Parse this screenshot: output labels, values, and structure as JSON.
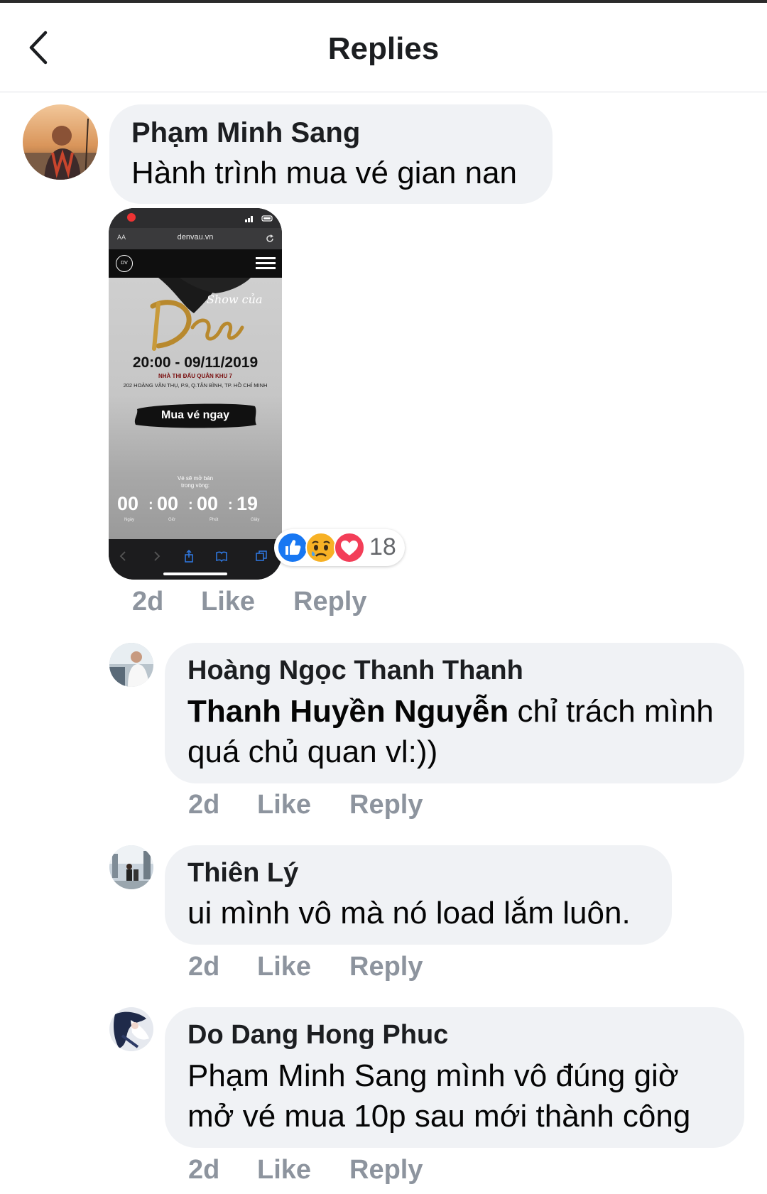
{
  "header": {
    "title": "Replies"
  },
  "main_comment": {
    "author": "Phạm Minh Sang",
    "text": "Hành trình mua vé gian nan",
    "image": {
      "url": "denvau.vn",
      "aa": "AA",
      "logo": "DV",
      "show_title": "Show của Đen",
      "date": "20:00 - 09/11/2019",
      "venue": "NHÀ THI ĐẤU QUÂN KHU 7",
      "address": "202 HOÀNG VĂN THỤ, P.9, Q.TÂN BÌNH, TP. HỒ CHÍ MINH",
      "button": "Mua vé ngay",
      "sale_note_1": "Vé sẽ mở bán",
      "sale_note_2": "trong vòng:",
      "countdown": {
        "days": "00",
        "hours": "00",
        "minutes": "00",
        "seconds": "19"
      },
      "units": {
        "days": "Ngày",
        "hours": "Giờ",
        "minutes": "Phút",
        "seconds": "Giây"
      }
    },
    "reactions": {
      "icons": [
        "like-icon",
        "sad-icon",
        "love-icon"
      ],
      "count": "18"
    },
    "time": "2d",
    "like": "Like",
    "reply": "Reply"
  },
  "replies": [
    {
      "author": "Hoàng Ngọc Thanh Thanh",
      "mention": "Thanh Huyền Nguyễn",
      "text_1": " chỉ trách mình",
      "text_2": "quá chủ quan vl:))",
      "time": "2d",
      "like": "Like",
      "reply": "Reply"
    },
    {
      "author": "Thiên Lý",
      "text_1": "ui mình vô mà nó load lắm luôn.",
      "time": "2d",
      "like": "Like",
      "reply": "Reply"
    },
    {
      "author": "Do Dang Hong Phuc",
      "text_1": "Phạm Minh Sang  mình vô đúng giờ",
      "text_2": "mở vé mua 10p sau mới thành công",
      "time": "2d",
      "like": "Like",
      "reply": "Reply"
    }
  ],
  "colors": {
    "bubble": "#f0f2f5",
    "meta_text": "#8d949e",
    "like_blue": "#1877f2",
    "love_red": "#f33e58",
    "sad_yellow": "#f7b125"
  }
}
